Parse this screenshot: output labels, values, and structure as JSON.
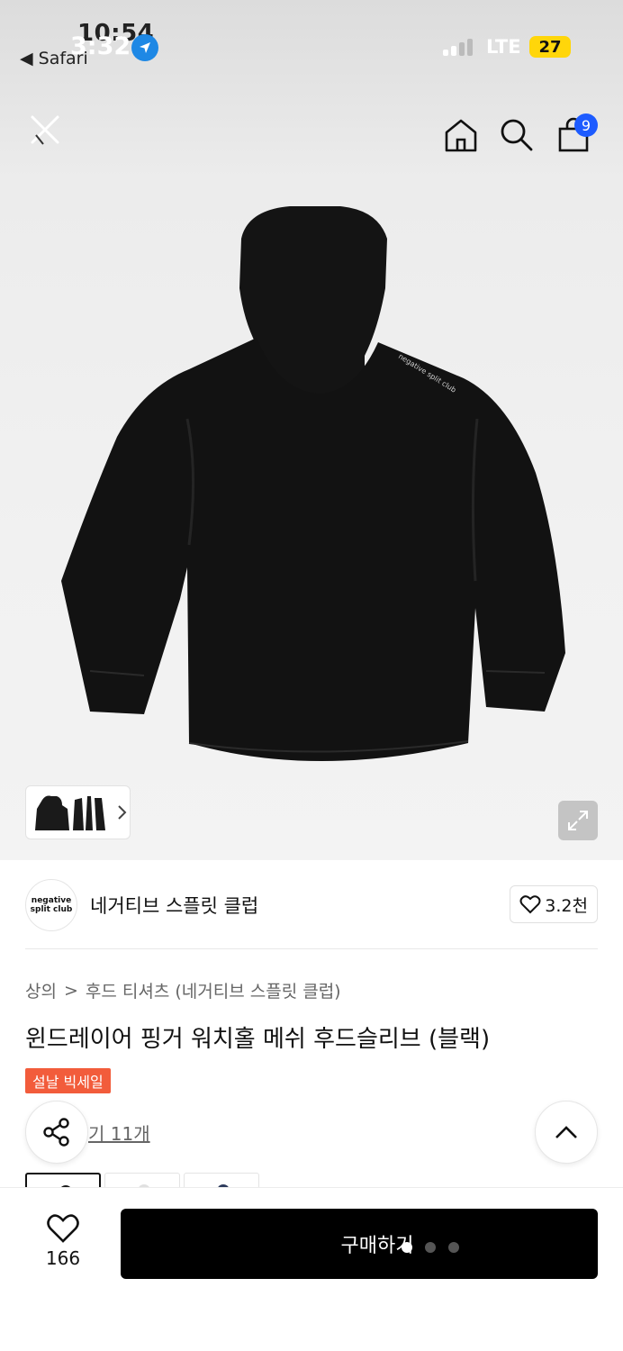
{
  "status_bar": {
    "time_under": "10:54",
    "time_over": "3:32",
    "back_app": "◀ Safari",
    "network": "LTE",
    "battery": "27"
  },
  "top_nav": {
    "cart_count": "9"
  },
  "brand": {
    "logo_line1": "negative",
    "logo_line2": "split club",
    "name": "네거티브 스플릿 클럽",
    "likes": "3.2천"
  },
  "breadcrumb": {
    "category": "상의",
    "separator": ">",
    "sub": "후드 티셔츠 (네거티브 스플릿 클럽)"
  },
  "product": {
    "title": "윈드레이어 핑거 워치홀 메쉬 후드슬리브 (블랙)",
    "badge": "설날 빅세일",
    "reviews_label": "기 11개",
    "logo_print": "negative split club"
  },
  "bottom_bar": {
    "wish_count": "166",
    "buy_label": "구매하기"
  },
  "colors": {
    "accent_blue": "#1d5bff",
    "sale_red": "#f25c3b",
    "buy_black": "#000000"
  },
  "color_options": [
    {
      "dot": "#1b1b1b"
    },
    {
      "dot": "#e0e0e0"
    },
    {
      "dot": "#2d3b5c"
    }
  ]
}
